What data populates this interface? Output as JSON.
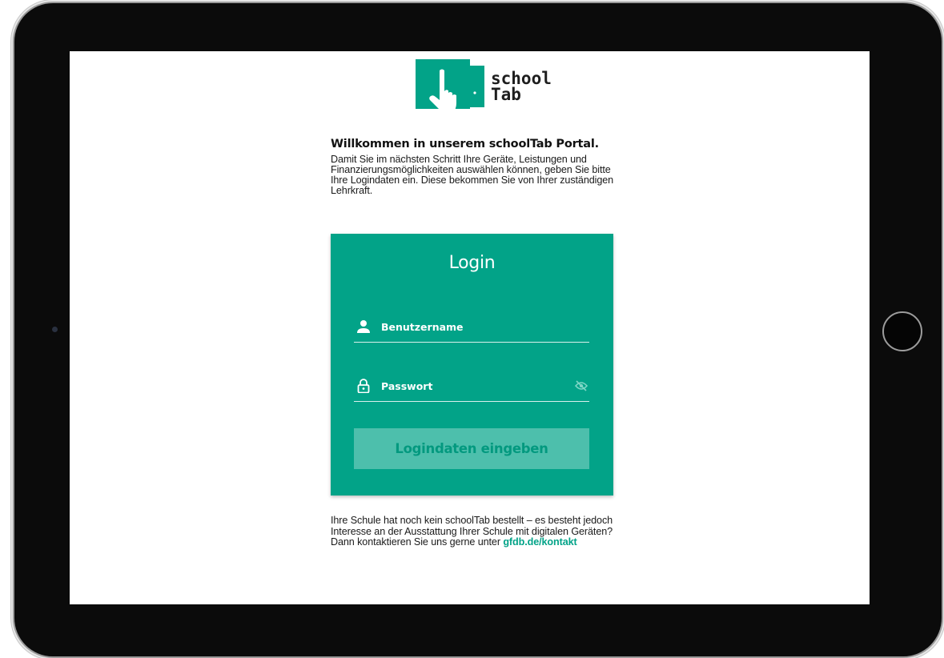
{
  "logo": {
    "line1": "school",
    "line2": "Tab",
    "brand_color": "#02a388"
  },
  "intro": {
    "heading": "Willkommen in unserem schoolTab Portal.",
    "text": "Damit Sie im nächsten Schritt Ihre Geräte, Leistungen und Finanzierungsmöglichkeiten auswählen können, geben Sie bitte Ihre Logindaten ein. Diese bekommen Sie von Ihrer zuständigen Lehrkraft."
  },
  "login": {
    "title": "Login",
    "username": {
      "placeholder": "Benutzername",
      "value": "",
      "icon": "user-icon"
    },
    "password": {
      "placeholder": "Passwort",
      "value": "",
      "icon": "lock-icon",
      "toggle_icon": "eye-off-icon"
    },
    "submit_label": "Logindaten eingeben",
    "card_color": "#02a388",
    "button_color": "#4dbfac"
  },
  "footer": {
    "text": "Ihre Schule hat noch kein schoolTab bestellt – es besteht jedoch Interesse an der Ausstattung Ihrer Schule mit digitalen Geräten? Dann kontaktieren Sie uns gerne unter ",
    "link_text": "gfdb.de/kontakt"
  }
}
